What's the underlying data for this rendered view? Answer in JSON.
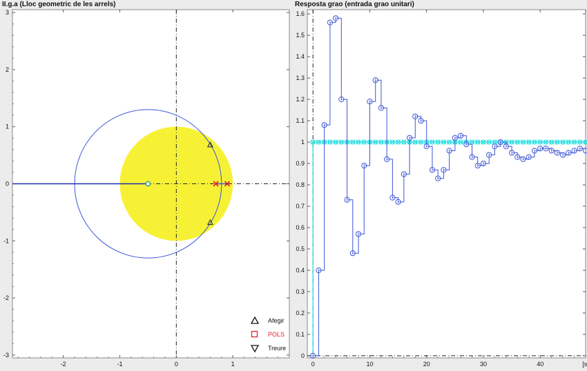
{
  "left_panel": {
    "title": "II.g.a (Lloc geometric de les arrels)",
    "x_ticks": [
      "-2",
      "-1",
      "0",
      "1"
    ],
    "y_ticks": [
      "3",
      "2",
      "1",
      "0",
      "-1",
      "-2",
      "-3"
    ]
  },
  "right_panel": {
    "title": "Resposta grao (entrada grao unitari)",
    "x_ticks": [
      "0",
      "10",
      "20",
      "30",
      "40",
      "[s]"
    ],
    "y_ticks": [
      "1.6",
      "1.5",
      "1.4",
      "1.3",
      "1.2",
      "1.1",
      "1",
      "0.9",
      "0.8",
      "0.7",
      "0.6",
      "0.5",
      "0.4",
      "0.3",
      "0.2",
      "0.1",
      "0"
    ]
  },
  "legend": {
    "add_label": "Afegir",
    "poles_label": "POLS",
    "remove_label": "Treure"
  },
  "colors": {
    "background": "#ececec",
    "plot_bg": "#ffffff",
    "unit_circle_fill": "#f7f135",
    "locus": "#3a55d8",
    "pole": "#e0202a",
    "reference": "#22dddd"
  },
  "chart_data": [
    {
      "type": "scatter",
      "title": "II.g.a (Lloc geometric de les arrels)",
      "xlim": [
        -2.9,
        2.0
      ],
      "ylim": [
        -3.05,
        3.05
      ],
      "unit_circle": {
        "center": [
          0,
          0
        ],
        "radius": 1
      },
      "locus_circle": {
        "center": [
          -0.5,
          0
        ],
        "radius": 1.3
      },
      "locus_axis_segment": [
        -2.9,
        -0.5
      ],
      "zero": [
        -0.5,
        0
      ],
      "poles": [
        [
          0.7,
          0
        ],
        [
          0.9,
          0
        ]
      ],
      "closed_loop_poles": [
        [
          0.6,
          0.68
        ],
        [
          0.6,
          -0.68
        ]
      ]
    },
    {
      "type": "line",
      "title": "Resposta grao (entrada grao unitari)",
      "xlim": [
        -1,
        48
      ],
      "ylim": [
        -0.01,
        1.62
      ],
      "step_response": {
        "t": [
          0,
          1,
          2,
          3,
          4,
          5,
          6,
          7,
          8,
          9,
          10,
          11,
          12,
          13,
          14,
          15,
          16,
          17,
          18,
          19,
          20,
          21,
          22,
          23,
          24,
          25,
          26,
          27,
          28,
          29,
          30,
          31,
          32,
          33,
          34,
          35,
          36,
          37,
          38,
          39,
          40,
          41,
          42,
          43,
          44,
          45,
          46,
          47,
          48
        ],
        "y": [
          0,
          0.4,
          1.08,
          1.56,
          1.58,
          1.2,
          0.73,
          0.48,
          0.57,
          0.89,
          1.19,
          1.29,
          1.16,
          0.92,
          0.74,
          0.72,
          0.85,
          1.02,
          1.12,
          1.1,
          0.98,
          0.87,
          0.83,
          0.87,
          0.96,
          1.02,
          1.03,
          0.99,
          0.93,
          0.89,
          0.9,
          0.94,
          0.98,
          1.0,
          0.98,
          0.95,
          0.93,
          0.92,
          0.93,
          0.96,
          0.97,
          0.97,
          0.96,
          0.95,
          0.94,
          0.95,
          0.96,
          0.97,
          0.96
        ]
      },
      "reference": {
        "t_start": 0,
        "value": 1
      }
    }
  ]
}
